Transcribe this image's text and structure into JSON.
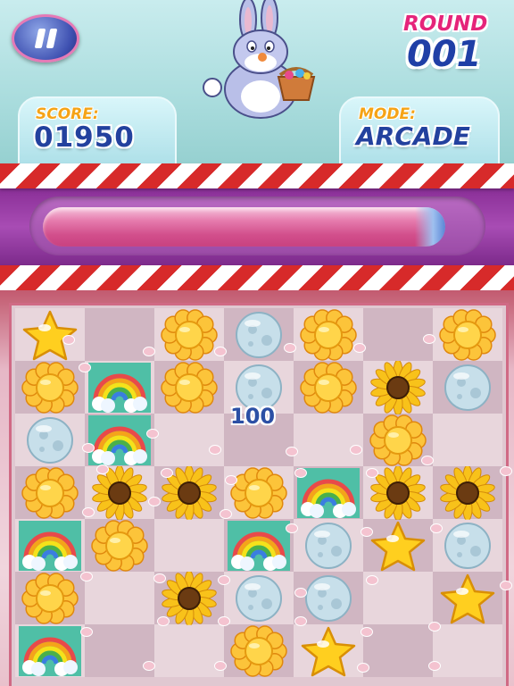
{
  "hud": {
    "round_label": "ROUND",
    "round_value": "001",
    "score_label": "SCORE:",
    "score_value": "01950",
    "mode_label": "MODE:",
    "mode_value": "ARCADE",
    "progress": 0.94
  },
  "icons": {
    "pause": "pause-icon",
    "mascot": "bunny-with-basket"
  },
  "colors": {
    "accent_pink": "#e5247a",
    "score_blue": "#23419e",
    "label_orange": "#f5a316",
    "stripe_red": "#d72a2a"
  },
  "board": {
    "rows": 7,
    "cols": 7,
    "floating_score": "100",
    "grid": [
      [
        "star",
        "",
        "flower",
        "moon",
        "flower",
        "",
        "flower"
      ],
      [
        "flower",
        "rainbow",
        "flower",
        "moon",
        "flower",
        "sunflower",
        "moon"
      ],
      [
        "moon",
        "rainbow",
        "",
        "",
        "",
        "flower",
        ""
      ],
      [
        "flower",
        "sunflower",
        "sunflower",
        "flower",
        "rainbow",
        "sunflower",
        "sunflower"
      ],
      [
        "rainbow",
        "flower",
        "",
        "rainbow",
        "moon",
        "star",
        "moon"
      ],
      [
        "flower",
        "",
        "sunflower",
        "moon",
        "moon",
        "",
        "star"
      ],
      [
        "rainbow",
        "",
        "",
        "flower",
        "star",
        "",
        ""
      ]
    ]
  }
}
